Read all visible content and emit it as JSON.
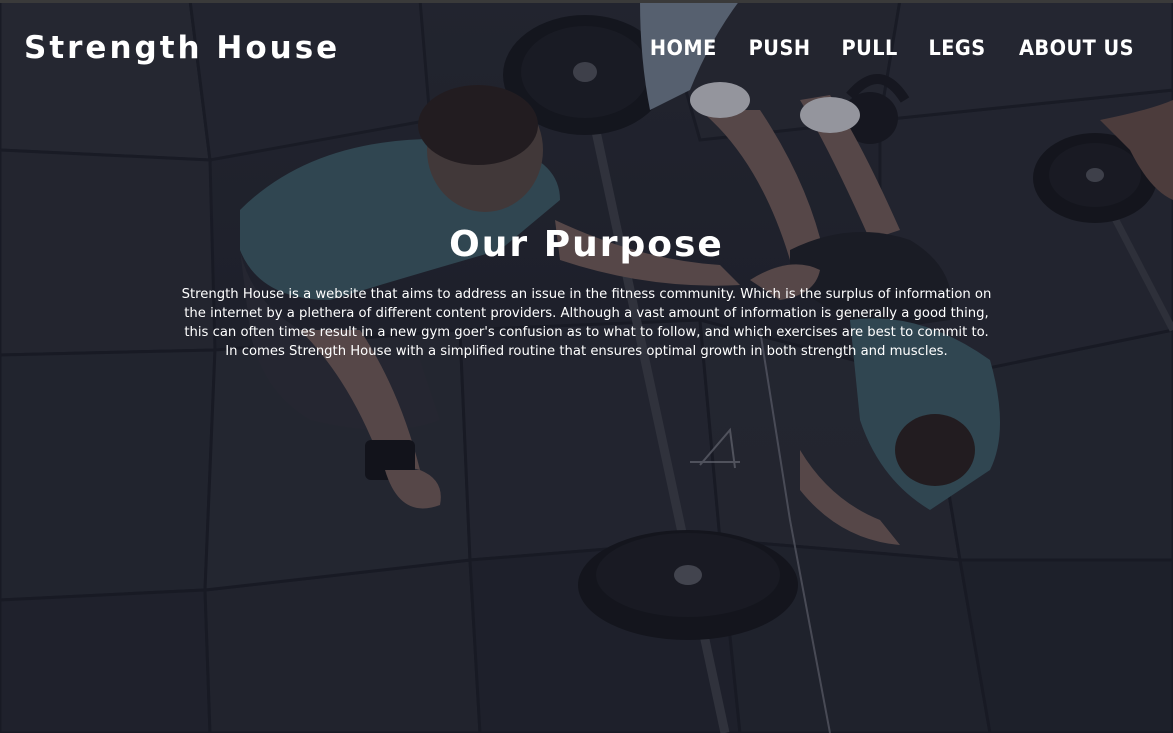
{
  "header": {
    "brand": "Strength House",
    "nav": [
      {
        "label": "HOME"
      },
      {
        "label": "PUSH"
      },
      {
        "label": "PULL"
      },
      {
        "label": "LEGS"
      },
      {
        "label": "ABOUT US"
      }
    ]
  },
  "hero": {
    "title": "Our Purpose",
    "body": "Strength House is a website that aims to address an issue in the fitness community. Which is the surplus of information on the internet by a plethera of different content providers. Although a vast amount of information is generally a good thing, this can often times result in a new gym goer's confusion as to what to follow, and which exercises are best to commit to. In comes Strength House with a simplified routine that ensures optimal growth in both strength and muscles."
  },
  "colors": {
    "text": "#ffffff",
    "overlay": "#141628"
  },
  "background": {
    "icon": "gym-floor-barbell-photo"
  }
}
